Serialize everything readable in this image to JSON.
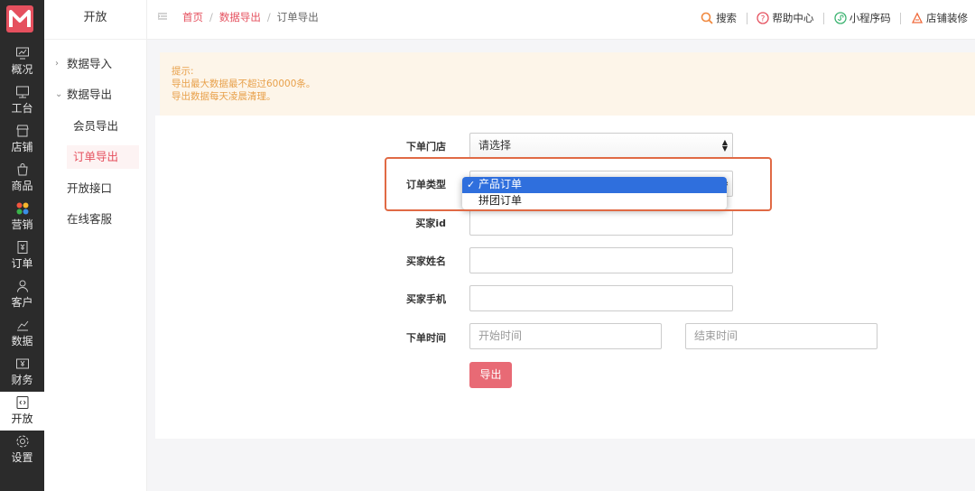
{
  "rail": {
    "items": [
      {
        "label": "概况",
        "icon": "monitor-chart-icon"
      },
      {
        "label": "工台",
        "icon": "desktop-icon"
      },
      {
        "label": "店铺",
        "icon": "store-icon"
      },
      {
        "label": "商品",
        "icon": "bag-icon"
      },
      {
        "label": "营销",
        "icon": "colorful-grid-icon"
      },
      {
        "label": "订单",
        "icon": "order-doc-icon"
      },
      {
        "label": "客户",
        "icon": "user-icon"
      },
      {
        "label": "数据",
        "icon": "bar-chart-icon"
      },
      {
        "label": "财务",
        "icon": "yen-icon"
      },
      {
        "label": "开放",
        "icon": "code-icon"
      },
      {
        "label": "设置",
        "icon": "gear-icon"
      }
    ],
    "active_index": 9
  },
  "sidebar": {
    "title": "开放",
    "items": [
      {
        "label": "数据导入"
      },
      {
        "label": "数据导出"
      },
      {
        "label": "会员导出"
      },
      {
        "label": "订单导出"
      },
      {
        "label": "开放接口"
      },
      {
        "label": "在线客服"
      }
    ]
  },
  "breadcrumb": {
    "home": "首页",
    "parent": "数据导出",
    "current": "订单导出",
    "separator": "/"
  },
  "toolbar": {
    "search": "搜索",
    "help": "帮助中心",
    "miniapp": "小程序码",
    "decorate": "店铺装修"
  },
  "notice": {
    "title": "提示:",
    "lines": [
      "导出最大数据最不超过60000条。",
      "导出数据每天凌晨清理。"
    ]
  },
  "form": {
    "store_label": "下单门店",
    "store_value": "请选择",
    "type_label": "订单类型",
    "type_options": [
      "产品订单",
      "拼团订单"
    ],
    "type_selected_index": 0,
    "buyer_id_label": "买家id",
    "buyer_name_label": "买家姓名",
    "buyer_phone_label": "买家手机",
    "time_label": "下单时间",
    "start_placeholder": "开始时间",
    "end_placeholder": "结束时间",
    "export_button": "导出"
  },
  "colors": {
    "accent": "#e5505e",
    "notice_bg": "#fdf5e9",
    "notice_text": "#e8a04a",
    "highlight_box": "#e06a45",
    "selected_option": "#2f6fdd"
  }
}
